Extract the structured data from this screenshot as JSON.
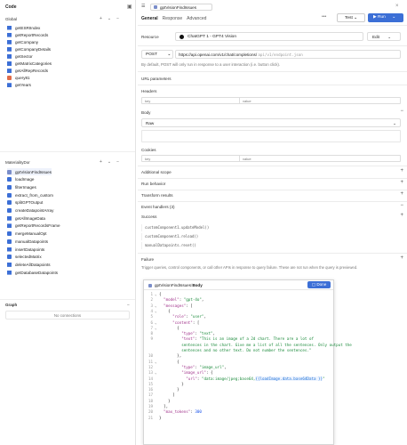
{
  "left": {
    "code_title": "Code",
    "global_title": "Global",
    "global_items": [
      {
        "label": "getESRIIndex",
        "kind": "rest"
      },
      {
        "label": "getReportRecords",
        "kind": "rest"
      },
      {
        "label": "getCompany",
        "kind": "rest"
      },
      {
        "label": "getCompanyDetails",
        "kind": "rest"
      },
      {
        "label": "getSector",
        "kind": "rest"
      },
      {
        "label": "getMatrixCategories",
        "kind": "rest"
      },
      {
        "label": "getAllRepRecords",
        "kind": "rest"
      },
      {
        "label": "query81",
        "kind": "sql"
      },
      {
        "label": "getYears",
        "kind": "rest"
      }
    ],
    "page_title": "MaterialityDor",
    "page_items": [
      {
        "label": "gptVisionFindIssues",
        "kind": "ret"
      },
      {
        "label": "loadImage",
        "kind": "js"
      },
      {
        "label": "filterImages",
        "kind": "js"
      },
      {
        "label": "extract_from_custom",
        "kind": "js"
      },
      {
        "label": "splitGPTOutput",
        "kind": "js"
      },
      {
        "label": "createDatapointArray",
        "kind": "js"
      },
      {
        "label": "getAllImageData",
        "kind": "rest"
      },
      {
        "label": "getReportRecordsFrame",
        "kind": "rest"
      },
      {
        "label": "mergeManualOpt",
        "kind": "js"
      },
      {
        "label": "manualDatapoints",
        "kind": "js"
      },
      {
        "label": "insertDatapoints",
        "kind": "rest"
      },
      {
        "label": "selectedMatrix",
        "kind": "js"
      },
      {
        "label": "deleteAllDatapoints",
        "kind": "rest"
      },
      {
        "label": "getDatabaseDatapoints",
        "kind": "rest"
      }
    ],
    "graph_title": "Graph",
    "graph_empty": "No connections"
  },
  "right": {
    "query_name": "gptVisionFindIssues",
    "tabs": [
      "General",
      "Response",
      "Advanced"
    ],
    "test_label": "Test",
    "run_label": "Run",
    "resource_label": "Resource",
    "resource_value": "ChatGPT 1 - GPT4 Vision",
    "edit_label": "Edit",
    "method": "POST",
    "url_base": "https://api.openai.com/v1/chat/completions/",
    "url_placeholder": "api/v1/endpoint.json",
    "note": "By default, POST will only run in response to a user interaction (i.e. button click).",
    "url_params_label": "URL parameters",
    "headers_label": "Headers",
    "key_placeholder": "key",
    "value_placeholder": "value",
    "body_label": "Body",
    "body_type": "Raw",
    "cookies_label": "Cookies",
    "additional_scope_label": "Additional scope",
    "run_behavior_label": "Run behavior",
    "transform_label": "Transform results",
    "event_handlers_label": "Event handlers (3)",
    "success_label": "Success",
    "success_lines": [
      "customComponent1.updateModel()",
      "customComponent1.reload()",
      "manualDatapoints.reset()"
    ],
    "failure_label": "Failure",
    "failure_note": "Trigger queries, control components, or call other APIs in response to query failure. These are not run when the query is previewed."
  },
  "editor": {
    "breadcrumb_query": "gptVisionFindIssues",
    "breadcrumb_sep": " / ",
    "breadcrumb_field": "Body",
    "done_label": "Done"
  },
  "colors": {
    "accent": "#3c6fd6",
    "string": "#1a8a3a",
    "key": "#a0318a",
    "number": "#1750eb"
  }
}
